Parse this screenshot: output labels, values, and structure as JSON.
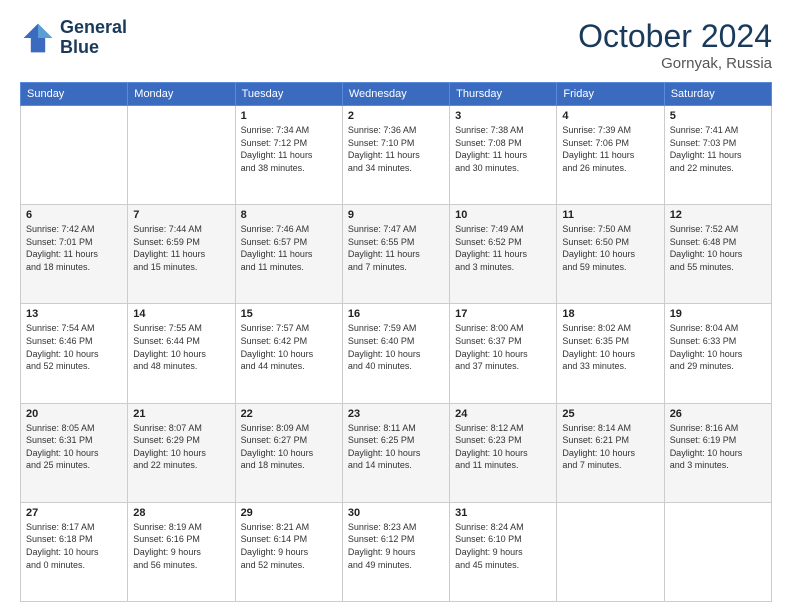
{
  "header": {
    "logo_line1": "General",
    "logo_line2": "Blue",
    "month": "October 2024",
    "location": "Gornyak, Russia"
  },
  "weekdays": [
    "Sunday",
    "Monday",
    "Tuesday",
    "Wednesday",
    "Thursday",
    "Friday",
    "Saturday"
  ],
  "weeks": [
    [
      {
        "day": "",
        "info": ""
      },
      {
        "day": "",
        "info": ""
      },
      {
        "day": "1",
        "info": "Sunrise: 7:34 AM\nSunset: 7:12 PM\nDaylight: 11 hours\nand 38 minutes."
      },
      {
        "day": "2",
        "info": "Sunrise: 7:36 AM\nSunset: 7:10 PM\nDaylight: 11 hours\nand 34 minutes."
      },
      {
        "day": "3",
        "info": "Sunrise: 7:38 AM\nSunset: 7:08 PM\nDaylight: 11 hours\nand 30 minutes."
      },
      {
        "day": "4",
        "info": "Sunrise: 7:39 AM\nSunset: 7:06 PM\nDaylight: 11 hours\nand 26 minutes."
      },
      {
        "day": "5",
        "info": "Sunrise: 7:41 AM\nSunset: 7:03 PM\nDaylight: 11 hours\nand 22 minutes."
      }
    ],
    [
      {
        "day": "6",
        "info": "Sunrise: 7:42 AM\nSunset: 7:01 PM\nDaylight: 11 hours\nand 18 minutes."
      },
      {
        "day": "7",
        "info": "Sunrise: 7:44 AM\nSunset: 6:59 PM\nDaylight: 11 hours\nand 15 minutes."
      },
      {
        "day": "8",
        "info": "Sunrise: 7:46 AM\nSunset: 6:57 PM\nDaylight: 11 hours\nand 11 minutes."
      },
      {
        "day": "9",
        "info": "Sunrise: 7:47 AM\nSunset: 6:55 PM\nDaylight: 11 hours\nand 7 minutes."
      },
      {
        "day": "10",
        "info": "Sunrise: 7:49 AM\nSunset: 6:52 PM\nDaylight: 11 hours\nand 3 minutes."
      },
      {
        "day": "11",
        "info": "Sunrise: 7:50 AM\nSunset: 6:50 PM\nDaylight: 10 hours\nand 59 minutes."
      },
      {
        "day": "12",
        "info": "Sunrise: 7:52 AM\nSunset: 6:48 PM\nDaylight: 10 hours\nand 55 minutes."
      }
    ],
    [
      {
        "day": "13",
        "info": "Sunrise: 7:54 AM\nSunset: 6:46 PM\nDaylight: 10 hours\nand 52 minutes."
      },
      {
        "day": "14",
        "info": "Sunrise: 7:55 AM\nSunset: 6:44 PM\nDaylight: 10 hours\nand 48 minutes."
      },
      {
        "day": "15",
        "info": "Sunrise: 7:57 AM\nSunset: 6:42 PM\nDaylight: 10 hours\nand 44 minutes."
      },
      {
        "day": "16",
        "info": "Sunrise: 7:59 AM\nSunset: 6:40 PM\nDaylight: 10 hours\nand 40 minutes."
      },
      {
        "day": "17",
        "info": "Sunrise: 8:00 AM\nSunset: 6:37 PM\nDaylight: 10 hours\nand 37 minutes."
      },
      {
        "day": "18",
        "info": "Sunrise: 8:02 AM\nSunset: 6:35 PM\nDaylight: 10 hours\nand 33 minutes."
      },
      {
        "day": "19",
        "info": "Sunrise: 8:04 AM\nSunset: 6:33 PM\nDaylight: 10 hours\nand 29 minutes."
      }
    ],
    [
      {
        "day": "20",
        "info": "Sunrise: 8:05 AM\nSunset: 6:31 PM\nDaylight: 10 hours\nand 25 minutes."
      },
      {
        "day": "21",
        "info": "Sunrise: 8:07 AM\nSunset: 6:29 PM\nDaylight: 10 hours\nand 22 minutes."
      },
      {
        "day": "22",
        "info": "Sunrise: 8:09 AM\nSunset: 6:27 PM\nDaylight: 10 hours\nand 18 minutes."
      },
      {
        "day": "23",
        "info": "Sunrise: 8:11 AM\nSunset: 6:25 PM\nDaylight: 10 hours\nand 14 minutes."
      },
      {
        "day": "24",
        "info": "Sunrise: 8:12 AM\nSunset: 6:23 PM\nDaylight: 10 hours\nand 11 minutes."
      },
      {
        "day": "25",
        "info": "Sunrise: 8:14 AM\nSunset: 6:21 PM\nDaylight: 10 hours\nand 7 minutes."
      },
      {
        "day": "26",
        "info": "Sunrise: 8:16 AM\nSunset: 6:19 PM\nDaylight: 10 hours\nand 3 minutes."
      }
    ],
    [
      {
        "day": "27",
        "info": "Sunrise: 8:17 AM\nSunset: 6:18 PM\nDaylight: 10 hours\nand 0 minutes."
      },
      {
        "day": "28",
        "info": "Sunrise: 8:19 AM\nSunset: 6:16 PM\nDaylight: 9 hours\nand 56 minutes."
      },
      {
        "day": "29",
        "info": "Sunrise: 8:21 AM\nSunset: 6:14 PM\nDaylight: 9 hours\nand 52 minutes."
      },
      {
        "day": "30",
        "info": "Sunrise: 8:23 AM\nSunset: 6:12 PM\nDaylight: 9 hours\nand 49 minutes."
      },
      {
        "day": "31",
        "info": "Sunrise: 8:24 AM\nSunset: 6:10 PM\nDaylight: 9 hours\nand 45 minutes."
      },
      {
        "day": "",
        "info": ""
      },
      {
        "day": "",
        "info": ""
      }
    ]
  ]
}
